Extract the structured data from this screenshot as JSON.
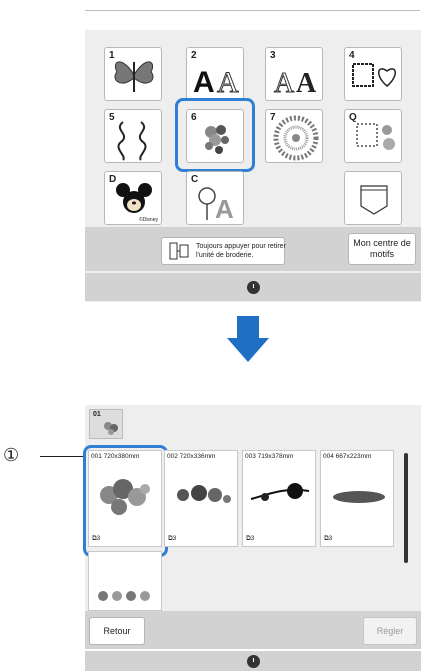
{
  "top_screen": {
    "tiles": [
      {
        "num": "1",
        "icon": "butterfly-icon"
      },
      {
        "num": "2",
        "icon": "font-aa-icon"
      },
      {
        "num": "3",
        "icon": "font-gothic-aa-icon"
      },
      {
        "num": "4",
        "icon": "frame-heart-icon"
      },
      {
        "num": "5",
        "icon": "ornament-icon"
      },
      {
        "num": "6",
        "icon": "floral-bouquet-icon"
      },
      {
        "num": "7",
        "icon": "mandala-icon"
      },
      {
        "num": "Q",
        "icon": "quilt-frame-icon"
      },
      {
        "num": "D",
        "icon": "mickey-icon",
        "sub": "©Disney"
      },
      {
        "num": "C",
        "icon": "rose-letter-icon"
      },
      {
        "num": "",
        "icon": "pocket-icon"
      }
    ],
    "selected_tile": "6",
    "notice_text": "Toujours appuyer pour retirer l'unité de broderie.",
    "center_button": "Mon centre de motifs"
  },
  "bottom_screen": {
    "category_tab": "01",
    "cards": [
      {
        "label": "001 720x380mm",
        "count": "3"
      },
      {
        "label": "002 720x336mm",
        "count": "3"
      },
      {
        "label": "003 719x378mm",
        "count": "3"
      },
      {
        "label": "004 667x223mm",
        "count": "3"
      },
      {
        "label": "",
        "count": ""
      }
    ],
    "selected_card": "001",
    "back_button": "Retour",
    "set_button": "Régler"
  },
  "callout": "①",
  "colors": {
    "highlight": "#2f7fd3",
    "arrow": "#1f6fc5",
    "panel": "#eeeeee",
    "bar": "#d2d2d2"
  }
}
